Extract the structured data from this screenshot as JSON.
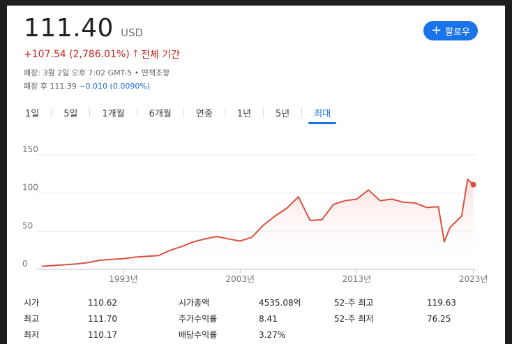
{
  "quote": {
    "price": "111.40",
    "currency": "USD",
    "change": "+107.54 (2,786.01%)",
    "period": "전체 기간",
    "closed_info": "폐장: 3월 2일 오후 7:02 GMT-5 • 면책조항",
    "after_hours_label": "폐장 후 111.39",
    "after_hours_change": "−0.010 (0.0090%)"
  },
  "follow_button": {
    "label": "팔로우",
    "color": "#1a73e8"
  },
  "tabs": [
    {
      "label": "1일"
    },
    {
      "label": "5일"
    },
    {
      "label": "1개월"
    },
    {
      "label": "6개월"
    },
    {
      "label": "연중"
    },
    {
      "label": "1년"
    },
    {
      "label": "5년"
    },
    {
      "label": "최대",
      "active": true
    }
  ],
  "chart_data": {
    "type": "area",
    "line_color": "#d9503f",
    "ylim": [
      0,
      150
    ],
    "yticks": [
      "0",
      "50",
      "100",
      "150"
    ],
    "xticks": [
      "1993년",
      "2003년",
      "2013년",
      "2023년"
    ],
    "grid": true,
    "x": [
      1986,
      1987,
      1988,
      1989,
      1990,
      1991,
      1992,
      1993,
      1994,
      1995,
      1996,
      1997,
      1998,
      1999,
      2000,
      2001,
      2002,
      2003,
      2004,
      2005,
      2006,
      2007,
      2008,
      2009,
      2010,
      2011,
      2012,
      2013,
      2014,
      2015,
      2016,
      2017,
      2018,
      2019,
      2020,
      2020.5,
      2021,
      2022,
      2022.5,
      2023
    ],
    "y": [
      4,
      5,
      6,
      7,
      9,
      12,
      13,
      14,
      16,
      17,
      18,
      25,
      30,
      36,
      40,
      43,
      40,
      37,
      42,
      58,
      70,
      80,
      95,
      64,
      65,
      85,
      90,
      92,
      104,
      90,
      92,
      88,
      87,
      81,
      82,
      36,
      55,
      70,
      118,
      111
    ]
  },
  "stats": {
    "rows": [
      [
        "시가",
        "110.62",
        "시가총액",
        "4535.08억",
        "52-주 최고",
        "119.63"
      ],
      [
        "최고",
        "111.70",
        "주가수익률",
        "8.41",
        "52-주 최저",
        "76.25"
      ],
      [
        "최저",
        "110.17",
        "배당수익률",
        "3.27%",
        "",
        ""
      ]
    ]
  }
}
